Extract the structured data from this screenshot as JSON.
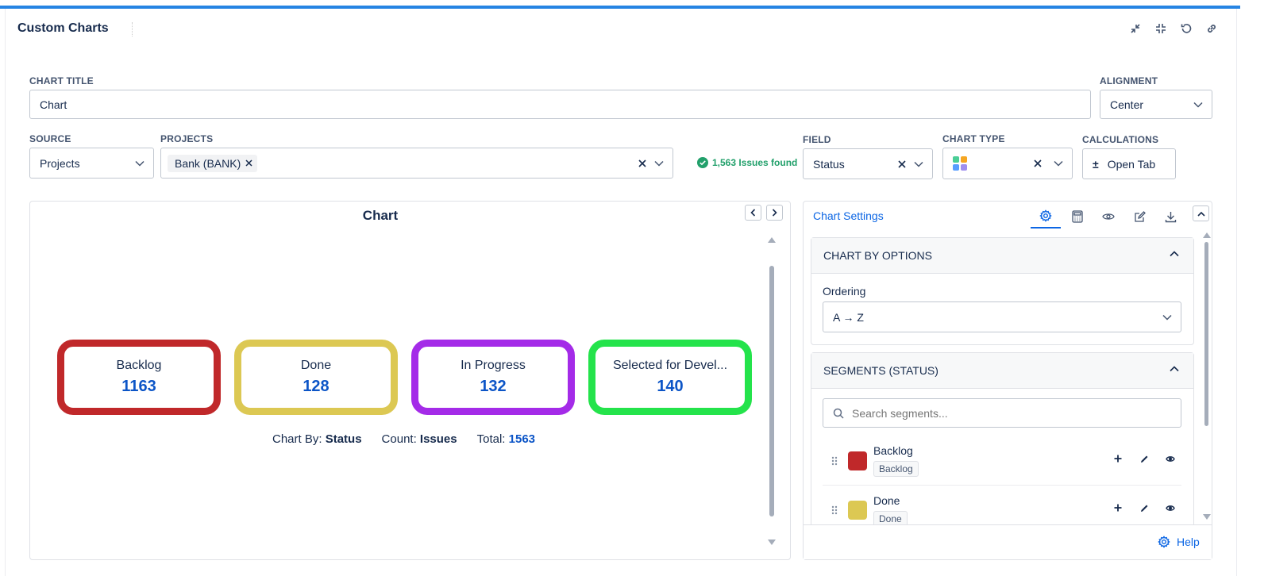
{
  "app": {
    "title": "Custom Charts"
  },
  "form": {
    "chart_title_label": "CHART TITLE",
    "chart_title_value": "Chart",
    "alignment_label": "ALIGNMENT",
    "alignment_value": "Center",
    "source_label": "SOURCE",
    "source_value": "Projects",
    "projects_label": "PROJECTS",
    "project_chip": "Bank (BANK)",
    "issues_found": "1,563 Issues found",
    "field_label": "FIELD",
    "field_value": "Status",
    "chart_type_label": "CHART TYPE",
    "calculations_label": "CALCULATIONS",
    "open_tab_label": "Open Tab",
    "open_tab_icon": "±"
  },
  "chart": {
    "title": "Chart",
    "summary": {
      "chart_by_label": "Chart By:",
      "chart_by_value": "Status",
      "count_label": "Count:",
      "count_value": "Issues",
      "total_label": "Total:",
      "total_value": "1563"
    }
  },
  "chart_data": {
    "type": "table",
    "categories": [
      "Backlog",
      "Done",
      "In Progress",
      "Selected for Devel..."
    ],
    "values": [
      1163,
      128,
      132,
      140
    ],
    "colors": [
      "#c0282a",
      "#dcc853",
      "#a42be8",
      "#24e34b"
    ],
    "title": "Chart",
    "total": 1563
  },
  "settings": {
    "title": "Chart Settings",
    "section1_title": "CHART BY OPTIONS",
    "ordering_label": "Ordering",
    "ordering_value": "A → Z",
    "section2_title": "SEGMENTS (STATUS)",
    "search_placeholder": "Search segments...",
    "segments": [
      {
        "name": "Backlog",
        "badge": "Backlog",
        "color": "#c0282a"
      },
      {
        "name": "Done",
        "badge": "Done",
        "color": "#dcc853"
      }
    ],
    "help_label": "Help"
  },
  "colors": {
    "accent": "#0c66e4",
    "success": "#22a06b",
    "value_blue": "#0c55c7"
  }
}
